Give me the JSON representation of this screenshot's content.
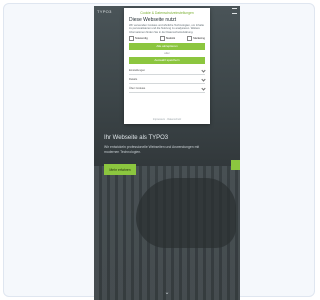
{
  "app": {
    "brand": "TYPO3",
    "hero": {
      "title": "Ihr Webseite als TYPO3",
      "text": "Wir entwickeln professionelle Webseiten und Anwendungen mit modernen Technologien.",
      "cta_label": "Mehr erfahren"
    }
  },
  "modal": {
    "top_link": "Cookie & Datenschutzeinstellungen",
    "title": "Diese Webseite nutzt",
    "description": "Wir verwenden Cookies und ähnliche Technologien, um Inhalte zu personalisieren und die Nutzung zu analysieren. Weitere Informationen finden Sie in der Datenschutzerklärung.",
    "checkboxes": [
      {
        "label": "Notwendig"
      },
      {
        "label": "Statistik"
      },
      {
        "label": "Marketing"
      }
    ],
    "accept_all_label": "Alle akzeptieren",
    "or_label": "oder",
    "accept_selected_label": "Auswahl speichern",
    "fields": [
      {
        "label": "Einstellungen"
      },
      {
        "label": "Details"
      },
      {
        "label": "Über Cookies"
      }
    ],
    "footer": "Impressum · Datenschutz"
  },
  "colors": {
    "accent": "#8cc63f",
    "background": "#f5f8fc"
  }
}
